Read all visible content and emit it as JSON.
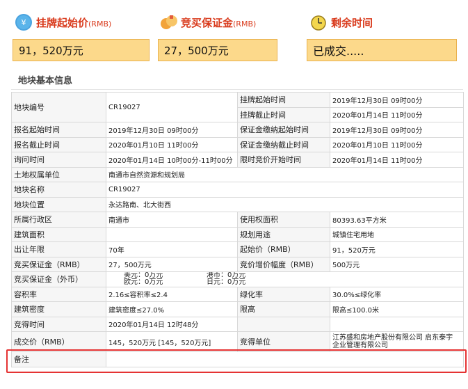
{
  "header": {
    "start_price": {
      "label": "挂牌起始价",
      "unit": "(RMB)",
      "value": "91，520万元"
    },
    "deposit": {
      "label": "竞买保证金",
      "unit": "(RMB)",
      "value": "27，500万元"
    },
    "remaining": {
      "label": "剩余时间",
      "value": "已成交....."
    }
  },
  "section_title": "地块基本信息",
  "table": {
    "parcel_no_label": "地块编号",
    "parcel_no": "CR19027",
    "listing_start_label": "挂牌起始时间",
    "listing_start": "2019年12月30日 09时00分",
    "listing_end_label": "挂牌截止时间",
    "listing_end": "2020年01月14日 11时00分",
    "reg_start_label": "报名起始时间",
    "reg_start": "2019年12月30日 09时00分",
    "deposit_start_label": "保证金缴纳起始时间",
    "deposit_start": "2019年12月30日 09时00分",
    "reg_end_label": "报名截止时间",
    "reg_end": "2020年01月10日 11时00分",
    "deposit_end_label": "保证金缴纳截止时间",
    "deposit_end": "2020年01月10日 11时00分",
    "inquiry_label": "询问时间",
    "inquiry": "2020年01月14日 10时00分-11时00分",
    "bidding_start_label": "限时竞价开始时间",
    "bidding_start": "2020年01月14日 11时00分",
    "owner_label": "土地权属单位",
    "owner": "南通市自然资源和规划局",
    "name_label": "地块名称",
    "name": "CR19027",
    "location_label": "地块位置",
    "location": "永达路南、北大街西",
    "district_label": "所属行政区",
    "district": "南通市",
    "use_area_label": "使用权面积",
    "use_area": "80393.63平方米",
    "build_area_label": "建筑面积",
    "build_area": "",
    "planned_use_label": "规划用途",
    "planned_use": "城镇住宅用地",
    "years_label": "出让年限",
    "years": "70年",
    "start_price_label": "起始价（RMB）",
    "start_price": "91，520万元",
    "deposit_rmb_label": "竞买保证金（RMB）",
    "deposit_rmb": "27，500万元",
    "increment_label": "竞价增价幅度（RMB）",
    "increment": "500万元",
    "deposit_fx_label": "竞买保证金（外币）",
    "usd": "美元：0万元",
    "hkd": "港币：0万元",
    "eur": "欧元：0万元",
    "jpy": "日元：0万元",
    "far_label": "容积率",
    "far": "2.16≤容积率≤2.4",
    "green_label": "绿化率",
    "green": "30.0%≤绿化率",
    "density_label": "建筑密度",
    "density": "建筑密度≤27.0%",
    "height_label": "限高",
    "height": "限高≤100.0米",
    "deal_time_label": "竞得时间",
    "deal_time": "2020年01月14日 12时48分",
    "deal_price_label": "成交价（RMB）",
    "deal_price": "145，520万元 [145，520万元]",
    "winner_label": "竞得单位",
    "winner_line1": "江苏盛和房地产股份有限公司 启东泰宇",
    "winner_line2": "企业管理有限公司",
    "remark_label": "备注",
    "remark": ""
  },
  "colors": {
    "accent": "#d93a1c",
    "box_fill": "#fcd98b",
    "highlight": "#e53333"
  }
}
